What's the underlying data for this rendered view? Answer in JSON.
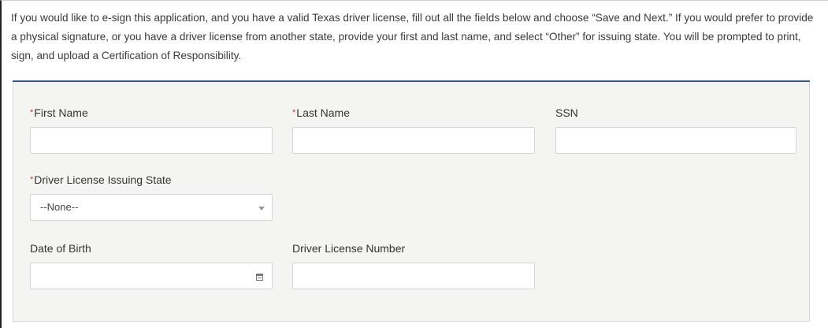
{
  "intro": {
    "text": "If you would like to e-sign this application, and you have a valid Texas driver license, fill out all the fields below and choose “Save and Next.” If you would prefer to provide a physical signature, or you have a driver license from another state, provide your first and last name, and select “Other” for issuing state. You will be prompted to print, sign, and upload a Certification of Responsibility."
  },
  "form": {
    "required_marker": "*",
    "first_name": {
      "label": "First Name",
      "value": "",
      "placeholder": ""
    },
    "last_name": {
      "label": "Last Name",
      "value": "",
      "placeholder": ""
    },
    "ssn": {
      "label": "SSN",
      "value": "",
      "placeholder": ""
    },
    "issuing_state": {
      "label": "Driver License Issuing State",
      "selected": "--None--"
    },
    "date_of_birth": {
      "label": "Date of Birth",
      "value": "",
      "placeholder": ""
    },
    "license_number": {
      "label": "Driver License Number",
      "value": "",
      "placeholder": ""
    }
  },
  "icons": {
    "date_picker": "calendar-icon",
    "select_arrow": "chevron-down-icon"
  },
  "colors": {
    "required": "#c23934",
    "divider": "#3a5a7c",
    "panel_bg": "#f4f4f3"
  }
}
